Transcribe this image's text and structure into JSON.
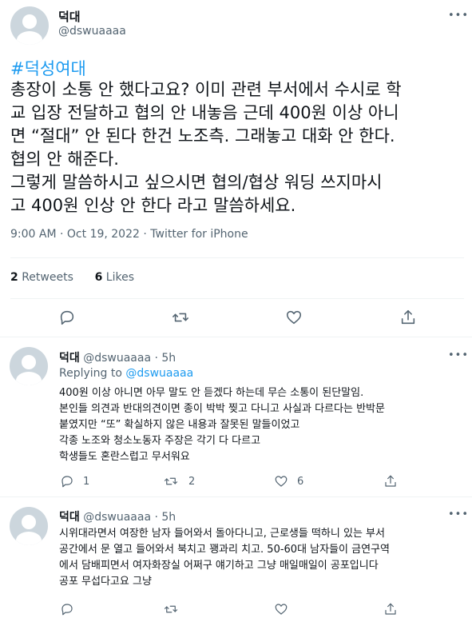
{
  "tweet": {
    "author_name": "덕대",
    "author_handle": "@dswuaaaa",
    "hashtag": "#덕성여대",
    "lines": [
      "총장이 소통 안 했다고요? 이미 관련 부서에서 수시로 학",
      "교 입장 전달하고 협의 안 내놓음 근데 400원 이상 아니",
      "면 “절대” 안 된다 한건 노조측. 그래놓고 대화 안 한다.",
      "협의 안 해준다.",
      "그렇게 말씀하시고 싶으시면 협의/협상 워딩 쓰지마시",
      "고 400원 인상 안 한다 라고 말씀하세요."
    ],
    "time": "9:00 AM",
    "separator": "·",
    "date": "Oct 19, 2022",
    "source": "Twitter for iPhone",
    "retweets_count": "2",
    "retweets_label": "Retweets",
    "likes_count": "6",
    "likes_label": "Likes"
  },
  "replies": [
    {
      "author_name": "덕대",
      "author_handle": "@dswuaaaa",
      "age": "· 5h",
      "replying_label": "Replying to",
      "replying_handle": "@dswuaaaa",
      "lines": [
        "400원 이상 아니면 아무 말도 안 듣겠다 하는데 무슨 소통이 된단말임.",
        "본인들 의견과 반대의견이면 종이 박박 찢고 다니고 사실과 다르다는 반박문",
        "붙였지만 “또” 확실하지 않은 내용과 잘못된 말들이었고",
        "각종 노조와 청소노동자 주장은 각기 다 다르고",
        "학생들도 혼란스럽고 무서워요"
      ],
      "reply_count": "1",
      "retweet_count": "2",
      "like_count": "6"
    },
    {
      "author_name": "덕대",
      "author_handle": "@dswuaaaa",
      "age": "· 5h",
      "lines": [
        "시위대라면서 여장한 남자 들어와서 돌아다니고, 근로생들 떡하니 있는 부서",
        "공간에서 문 열고 들어와서 북치고 꽹과리 치고. 50-60대 남자들이 금연구역",
        "에서 담배피면서 여자화장실 어쩌구 얘기하고 그냥 매일매일이 공포입니다",
        "공포 무섭다고요 그냥"
      ]
    }
  ],
  "icons": {
    "more": "more-icon",
    "reply": "reply-icon",
    "retweet": "retweet-icon",
    "like": "like-icon",
    "share": "share-icon"
  },
  "colors": {
    "link": "#1d9bf0",
    "secondary_text": "#536471",
    "divider": "#eff3f4",
    "avatar": "#ccd6dd"
  }
}
